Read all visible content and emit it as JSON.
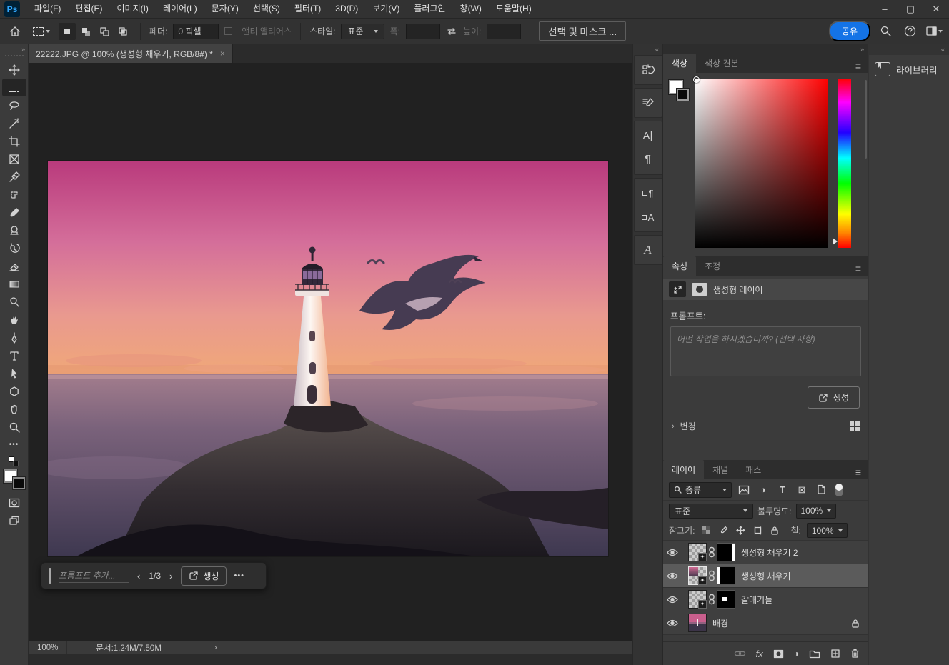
{
  "window": {
    "minimize": "–",
    "maximize": "▢",
    "close": "✕"
  },
  "menu_bar": {
    "logo": "Ps",
    "items": [
      "파일(F)",
      "편집(E)",
      "이미지(I)",
      "레이어(L)",
      "문자(Y)",
      "선택(S)",
      "필터(T)",
      "3D(D)",
      "보기(V)",
      "플러그인",
      "창(W)",
      "도움말(H)"
    ]
  },
  "options_bar": {
    "feather_label": "페더:",
    "feather_value": "0 픽셀",
    "antialias_label": "앤티 앨리어스",
    "style_label": "스타일:",
    "style_value": "표준",
    "width_label": "폭:",
    "height_label": "높이:",
    "select_mask_label": "선택 및 마스크 ...",
    "share_label": "공유"
  },
  "toolbar": {
    "tools": [
      "move",
      "rectangular-marquee",
      "lasso",
      "magic-wand",
      "crop",
      "frame",
      "eyedropper",
      "spot-healing",
      "brush",
      "clone-stamp",
      "history-brush",
      "eraser",
      "gradient",
      "dodge",
      "smudge",
      "pen",
      "type",
      "path-select",
      "shape",
      "hand",
      "zoom"
    ],
    "selected_tool": "rectangular-marquee",
    "more_glyph": "•••",
    "collapse_glyph": "»"
  },
  "document": {
    "tab_title": "22222.JPG @ 100% (생성형 채우기, RGB/8#) *",
    "close_glyph": "×",
    "zoom_level": "100%",
    "doc_info": "문서:1.24M/7.50M",
    "expand_glyph": "›"
  },
  "prompt_bar": {
    "placeholder": "프롬프트 추가...",
    "prev_glyph": "‹",
    "page": "1/3",
    "next_glyph": "›",
    "generate_label": "생성",
    "more_glyph": "•••"
  },
  "panels": {
    "collapse_left": "«",
    "collapse_right": "»",
    "color": {
      "tabs": [
        "색상",
        "색상 견본"
      ],
      "active_tab": "색상",
      "menu_glyph": "≡"
    },
    "properties": {
      "tabs": [
        "속성",
        "조정"
      ],
      "active_tab": "속성",
      "layer_type": "생성형 레이어",
      "prompt_label": "프롬프트:",
      "prompt_placeholder": "어떤 작업을 하시겠습니까? (선택 사항)",
      "generate_label": "생성",
      "variations_label": "변경",
      "variations_arrow": "›"
    },
    "layers": {
      "tabs": [
        "레이어",
        "채널",
        "패스"
      ],
      "active_tab": "레이어",
      "menu_glyph": "≡",
      "filter_value": "종류",
      "adjustment_glyph": "◑",
      "type_glyph": "T",
      "frame_glyph": "⊠",
      "blend_mode": "표준",
      "opacity_label": "불투명도:",
      "opacity_value": "100%",
      "lock_label": "잠그기:",
      "fill_label": "칠:",
      "fill_value": "100%",
      "fx_label": "fx",
      "rows": [
        {
          "name": "생성형 채우기 2",
          "type": "generative",
          "visible": true,
          "selected": false
        },
        {
          "name": "생성형 채우기",
          "type": "generative",
          "visible": true,
          "selected": true
        },
        {
          "name": "갈매기들",
          "type": "generative",
          "visible": true,
          "selected": false
        },
        {
          "name": "배경",
          "type": "background",
          "visible": true,
          "locked": true,
          "selected": false
        }
      ]
    },
    "libraries": {
      "label": "라이브러리"
    },
    "icon_strip": [
      "history",
      "brush-settings",
      "character",
      "paragraph",
      "paragraph-styles",
      "character-styles",
      "glyphs"
    ],
    "icon_strip_glyphs": {
      "character": "A|",
      "paragraph": "¶",
      "paragraph_styles": "¶",
      "character_styles": "A",
      "glyphs": "A"
    }
  },
  "colors": {
    "accent_blue": "#1473e6",
    "ui_panel": "#3b3b3b",
    "pasteboard": "#212121",
    "sky_top": "#b93a7c",
    "sky_horizon": "#f0a878",
    "sea_bottom": "#3e3850"
  }
}
